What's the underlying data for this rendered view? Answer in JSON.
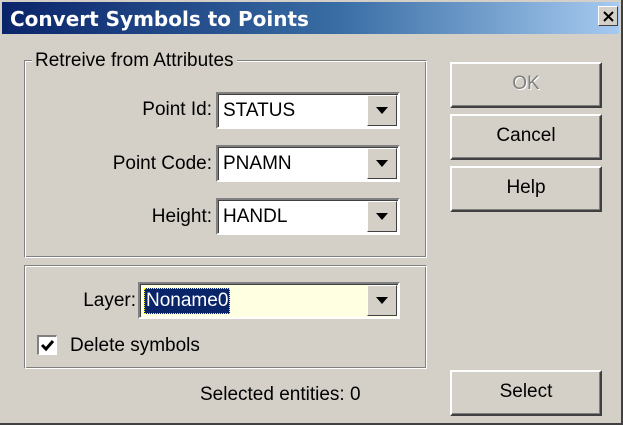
{
  "dialog": {
    "title": "Convert Symbols to Points",
    "close_glyph": "✕"
  },
  "attributes_group": {
    "legend": "Retreive from Attributes",
    "point_id": {
      "label": "Point Id:",
      "value": "STATUS"
    },
    "point_code": {
      "label": "Point Code:",
      "value": "PNAMN"
    },
    "height": {
      "label": "Height:",
      "value": "HANDL"
    }
  },
  "layer_group": {
    "layer": {
      "label": "Layer:",
      "value": "Noname0",
      "selected_bg": "#0a246a",
      "field_bg": "#ffffe1"
    },
    "delete_symbols": {
      "label": "Delete symbols",
      "checked": true
    }
  },
  "buttons": {
    "ok": {
      "label": "OK",
      "enabled": false
    },
    "cancel": {
      "label": "Cancel"
    },
    "help": {
      "label": "Help"
    },
    "select": {
      "label": "Select"
    }
  },
  "status": {
    "selected_entities": "Selected entities: 0"
  },
  "colors": {
    "title_start": "#0a246a",
    "title_end": "#a6caf0",
    "face": "#d4d0c8"
  }
}
